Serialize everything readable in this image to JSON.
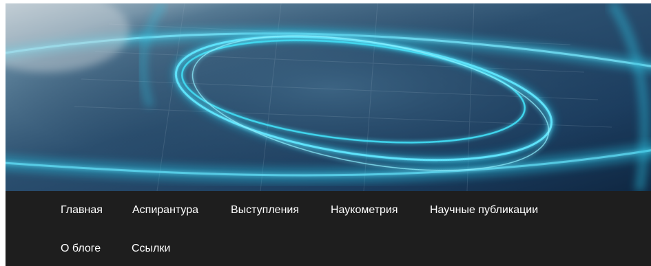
{
  "header": {
    "banner_image": "abstract-blue-light-rings-image"
  },
  "nav": {
    "items": [
      {
        "label": "Главная"
      },
      {
        "label": "Аспирантура"
      },
      {
        "label": "Выступления"
      },
      {
        "label": "Наукометрия"
      },
      {
        "label": "Научные публикации"
      },
      {
        "label": "О блоге"
      },
      {
        "label": "Ссылки"
      }
    ]
  },
  "colors": {
    "nav_background": "#1e1e1e",
    "nav_text": "#ffffff",
    "ring_glow": "#3fd6ee"
  }
}
